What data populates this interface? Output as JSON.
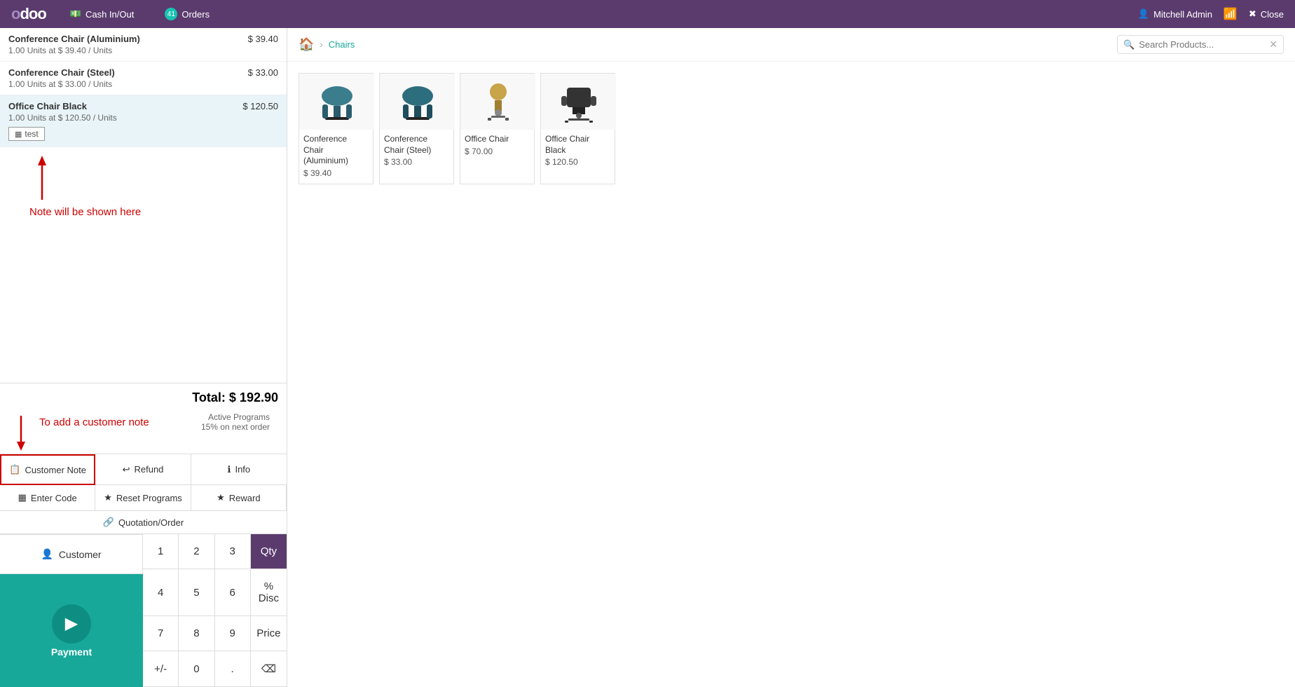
{
  "app": {
    "logo": "odoo",
    "nav": {
      "cash_in_out": "Cash In/Out",
      "orders": "Orders",
      "orders_badge": "41",
      "user": "Mitchell Admin",
      "close": "Close"
    }
  },
  "order": {
    "lines": [
      {
        "name": "Conference Chair (Aluminium)",
        "qty": "1.00",
        "unit": "Units",
        "unit_price": "39.40",
        "price": "$ 39.40",
        "note": null
      },
      {
        "name": "Conference Chair (Steel)",
        "qty": "1.00",
        "unit": "Units",
        "unit_price": "33.00",
        "price": "$ 33.00",
        "note": null
      },
      {
        "name": "Office Chair Black",
        "qty": "1.00",
        "unit": "Units",
        "unit_price": "120.50",
        "price": "$ 120.50",
        "note": "test",
        "selected": true
      }
    ],
    "annotation_up": "Note will be shown here",
    "total_label": "Total:",
    "total_value": "$ 192.90",
    "annotation_down": "To add a customer note",
    "active_programs_label": "Active Programs",
    "active_programs_value": "15% on next order"
  },
  "action_buttons": [
    {
      "label": "Customer Note",
      "icon": "📋",
      "highlighted": true
    },
    {
      "label": "Refund",
      "icon": "↩"
    },
    {
      "label": "Info",
      "icon": "ℹ"
    },
    {
      "label": "Enter Code",
      "icon": "▦"
    },
    {
      "label": "Reset Programs",
      "icon": "★"
    },
    {
      "label": "Reward",
      "icon": "★"
    }
  ],
  "quotation_btn": "Quotation/Order",
  "customer_btn": "Customer",
  "numpad": {
    "keys": [
      "1",
      "2",
      "3",
      "Qty",
      "4",
      "5",
      "6",
      "% Disc",
      "7",
      "8",
      "9",
      "Price",
      "+/-",
      "0",
      ".",
      "⌫"
    ]
  },
  "payment_btn": "Payment",
  "product_browser": {
    "home_icon": "🏠",
    "breadcrumb": "Chairs",
    "search_placeholder": "Search Products...",
    "products": [
      {
        "name": "Conference Chair (Aluminium)",
        "price": "$ 39.40",
        "emoji": "🪑"
      },
      {
        "name": "Conference Chair (Steel)",
        "price": "$ 33.00",
        "emoji": "🪑"
      },
      {
        "name": "Office Chair",
        "price": "$ 70.00",
        "emoji": "🪑"
      },
      {
        "name": "Office Chair Black",
        "price": "$ 120.50",
        "emoji": "🖥️"
      }
    ]
  }
}
